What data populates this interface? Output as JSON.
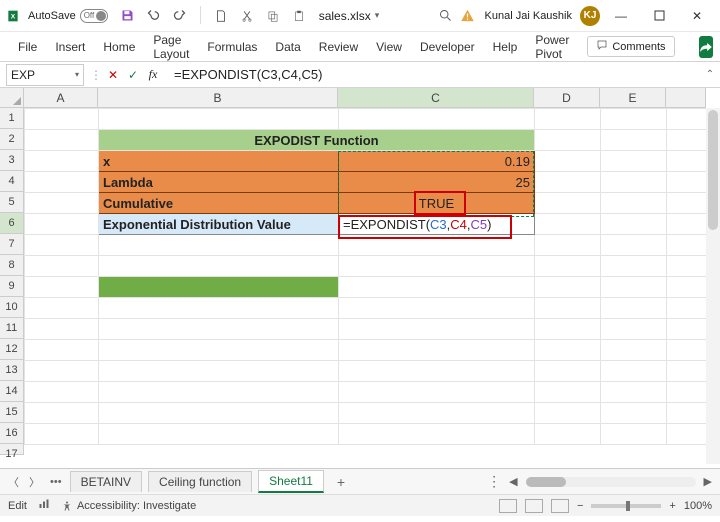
{
  "titlebar": {
    "autosave_label": "AutoSave",
    "autosave_state": "Off",
    "filename": "sales.xlsx",
    "user_name": "Kunal Jai Kaushik",
    "user_initials": "KJ"
  },
  "ribbon": {
    "tabs": [
      "File",
      "Insert",
      "Home",
      "Page Layout",
      "Formulas",
      "Data",
      "Review",
      "View",
      "Developer",
      "Help",
      "Power Pivot"
    ],
    "comments_label": "Comments"
  },
  "formula_bar": {
    "namebox": "EXP",
    "formula": "=EXPONDIST(C3,C4,C5)"
  },
  "columns": [
    "A",
    "B",
    "C",
    "D",
    "E"
  ],
  "rows": [
    "1",
    "2",
    "3",
    "4",
    "5",
    "6",
    "7",
    "8",
    "9",
    "10",
    "11",
    "12",
    "13",
    "14",
    "15",
    "16",
    "17"
  ],
  "cells": {
    "title": "EXPODIST Function",
    "r3_label": "x",
    "r3_val": "0.19",
    "r4_label": "Lambda",
    "r4_val": "25",
    "r5_label": "Cumulative",
    "r5_val": "TRUE",
    "r6_label": "Exponential Distribution Value",
    "r6_formula_prefix": "=EXPONDIST(",
    "r6_ref1": "C3",
    "r6_ref2": "C4",
    "r6_ref3": "C5",
    "r6_formula_suffix": ")"
  },
  "sheet_tabs": {
    "tabs": [
      "BETAINV",
      "Ceiling function",
      "Sheet11"
    ],
    "active": 2
  },
  "statusbar": {
    "mode": "Edit",
    "accessibility": "Accessibility: Investigate",
    "zoom": "100%"
  }
}
